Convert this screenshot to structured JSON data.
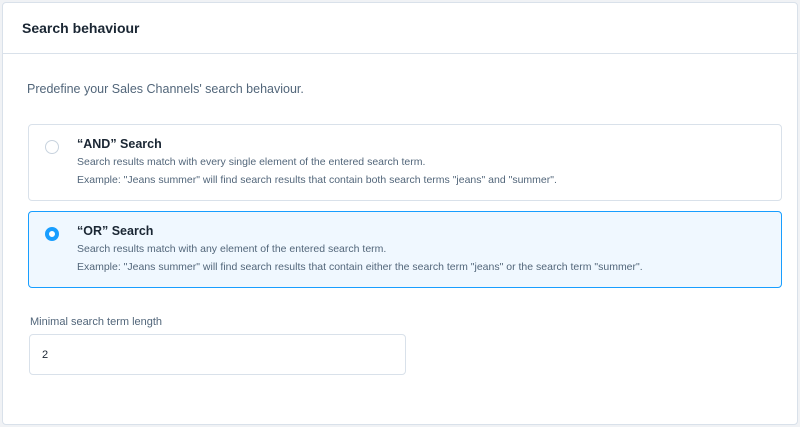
{
  "card": {
    "title": "Search behaviour",
    "description": "Predefine your Sales Channels' search behaviour."
  },
  "options": [
    {
      "title": "“AND” Search",
      "line1": "Search results match with every single element of the entered search term.",
      "line2": "Example: \"Jeans summer\" will find search results that contain both search terms \"jeans\" and \"summer\".",
      "selected": false
    },
    {
      "title": "“OR” Search",
      "line1": "Search results match with any element of the entered search term.",
      "line2": "Example: \"Jeans summer\" will find search results that contain either the search term \"jeans\" or the search term \"summer\".",
      "selected": true
    }
  ],
  "min_length": {
    "label": "Minimal search term length",
    "value": "2"
  },
  "colors": {
    "accent": "#189eff",
    "selected_bg": "#f0f8ff",
    "border": "#d9e1ea"
  }
}
